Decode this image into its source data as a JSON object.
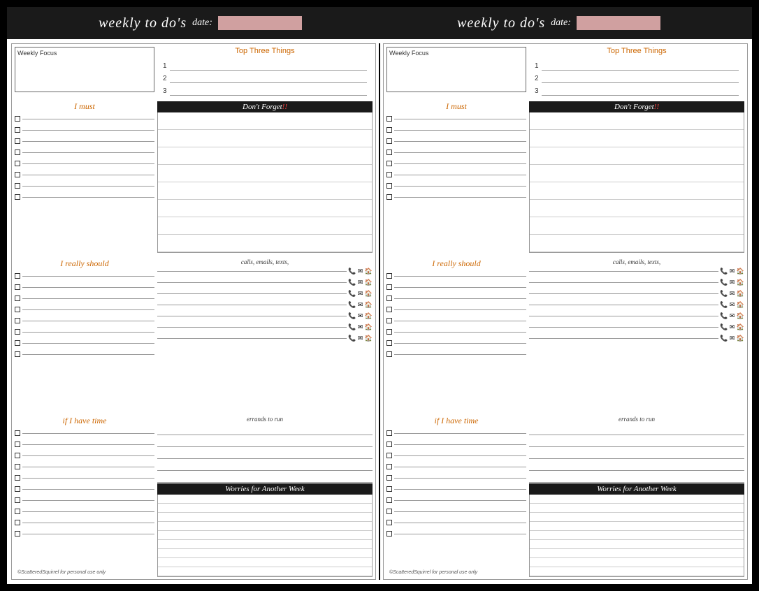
{
  "header": {
    "left": {
      "title": "weekly to do's",
      "date_label": "date:"
    },
    "right": {
      "title": "weekly to do's",
      "date_label": "date:"
    }
  },
  "panel": {
    "weekly_focus_label": "Weekly Focus",
    "top_three_title": "Top Three Things",
    "top_three_items": [
      "1",
      "2",
      "3"
    ],
    "i_must_title": "I must",
    "dont_forget_title": "Don't Forget",
    "dont_forget_exclaim": "!!",
    "i_really_title": "I really should",
    "calls_title": "calls, emails, texts,",
    "errands_title": "errands to run",
    "if_time_title": "if I have time",
    "worries_title": "Worries for Another Week"
  },
  "footer": {
    "brand": "©ScatteredSquirrel for personal use only"
  },
  "colors": {
    "orange": "#cc6600",
    "black_header": "#1a1a1a",
    "date_bg": "#c8a0a0"
  }
}
